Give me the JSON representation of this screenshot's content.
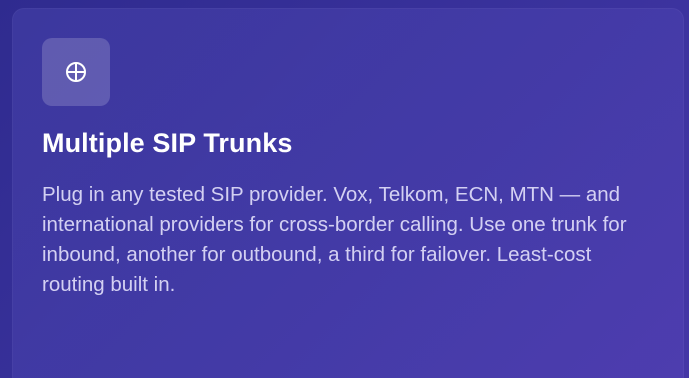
{
  "card": {
    "icon": "circled-plus-icon",
    "title": "Multiple SIP Trunks",
    "description": "Plug in any tested SIP provider. Vox, Telkom, ECN, MTN — and international providers for cross-border calling. Use one trunk for inbound, another for outbound, a third for failover. Least-cost routing built in."
  },
  "colors": {
    "background": "#2f2b8f",
    "card_tint": "#4a44aa",
    "icon_tile": "#6a66bf",
    "title": "#ffffff",
    "body_text": "#e3e1fb"
  }
}
